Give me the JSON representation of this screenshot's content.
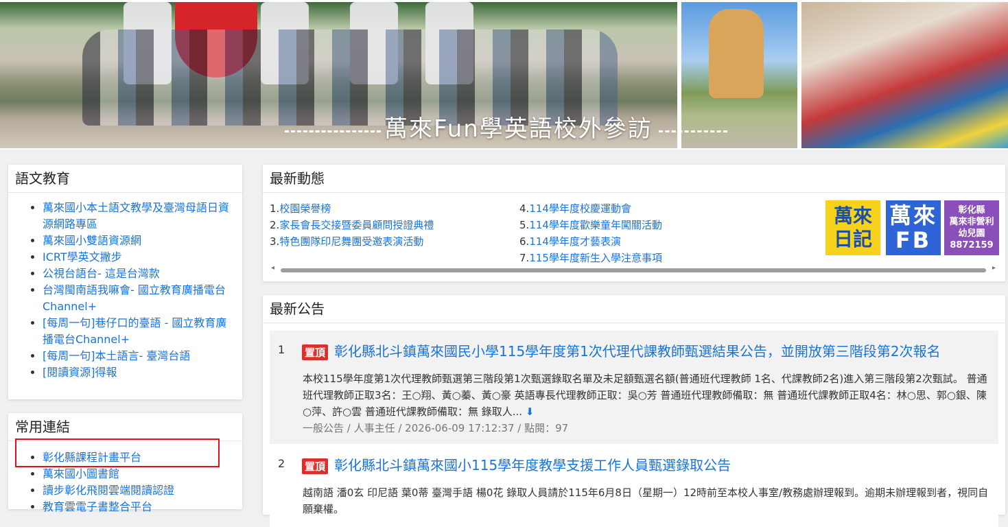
{
  "banner": {
    "title": "萬來Fun學英語校外參訪"
  },
  "lang_panel": {
    "title": "語文教育",
    "items": [
      "萬來國小本土語文教學及臺灣母語日資源網路專區",
      "萬來國小雙語資源網",
      "ICRT學英文撇步",
      "公視台語台- 這是台灣款",
      "台灣閩南語我嘛會- 國立教育廣播電台Channel+",
      "[每周一句]巷仔口的臺語 - 國立教育廣播電台Channel+",
      "[每周一句]本土語言- 臺灣台語",
      "[閱讀資源]得報"
    ]
  },
  "common_panel": {
    "title": "常用連結",
    "items": [
      "彰化縣課程計畫平台",
      "萬來國小圖書館",
      "讀步彰化飛閱雲端閱讀認證",
      "教育雲電子書整合平台"
    ]
  },
  "news_panel": {
    "title": "最新動態",
    "col1": [
      {
        "num": "1.",
        "text": "校園榮譽榜"
      },
      {
        "num": "2.",
        "text": "家長會長交接暨委員顧問授證典禮"
      },
      {
        "num": "3.",
        "text": "特色團隊印尼舞團受邀表演活動"
      }
    ],
    "col2": [
      {
        "num": "4.",
        "text": "114學年度校慶運動會"
      },
      {
        "num": "5.",
        "text": "114學年度歡樂童年闖關活動"
      },
      {
        "num": "6.",
        "text": "114學年度才藝表演"
      },
      {
        "num": "7.",
        "text": "115學年度新生入學注意事項"
      }
    ],
    "promos": {
      "diary_line1": "萬來",
      "diary_line2": "日記",
      "fb_line1": "萬來",
      "fb_line2": "FB",
      "kinder_line1": "彰化縣",
      "kinder_line2": "萬來非營利",
      "kinder_line3": "幼兒園",
      "kinder_line4": "8872159"
    }
  },
  "notice_panel": {
    "title": "最新公告",
    "items": [
      {
        "num": "1",
        "badge": "置頂",
        "title": "彰化縣北斗鎮萬來國民小學115學年度第1次代理代課教師甄選結果公告，並開放第三階段第2次報名",
        "body": "本校115學年度第1次代理教師甄選第三階段第1次甄選錄取名單及未足額甄選名額(普通班代理教師 1名、代課教師2名)進入第三階段第2次甄試。 普通班代理教師正取3名：王○翔、黃○蓁、黃○豪 英語專長代理教師正取：吳○芳 普通班代理教師備取：無 普通班代課教師正取4名：林○思、郭○銀、陳○萍、許○雲 普通班代課教師備取：無 錄取人...",
        "meta": "一般公告 / 人事主任 / 2026-06-09 17:12:37 / 點閱：97"
      },
      {
        "num": "2",
        "badge": "置頂",
        "title": "彰化縣北斗鎮萬來國小115學年度教學支援工作人員甄選錄取公告",
        "body": "越南語 潘0玄 印尼語 葉0蒂 臺灣手語 楊0花 錄取人員請於115年6月8日（星期一）12時前至本校人事室/教務處辦理報到。逾期未辦理報到者，視同自願棄權。"
      }
    ]
  },
  "colors": {
    "link": "#1a73d9",
    "badge": "#d9302c",
    "highlight": "#e0101a"
  }
}
